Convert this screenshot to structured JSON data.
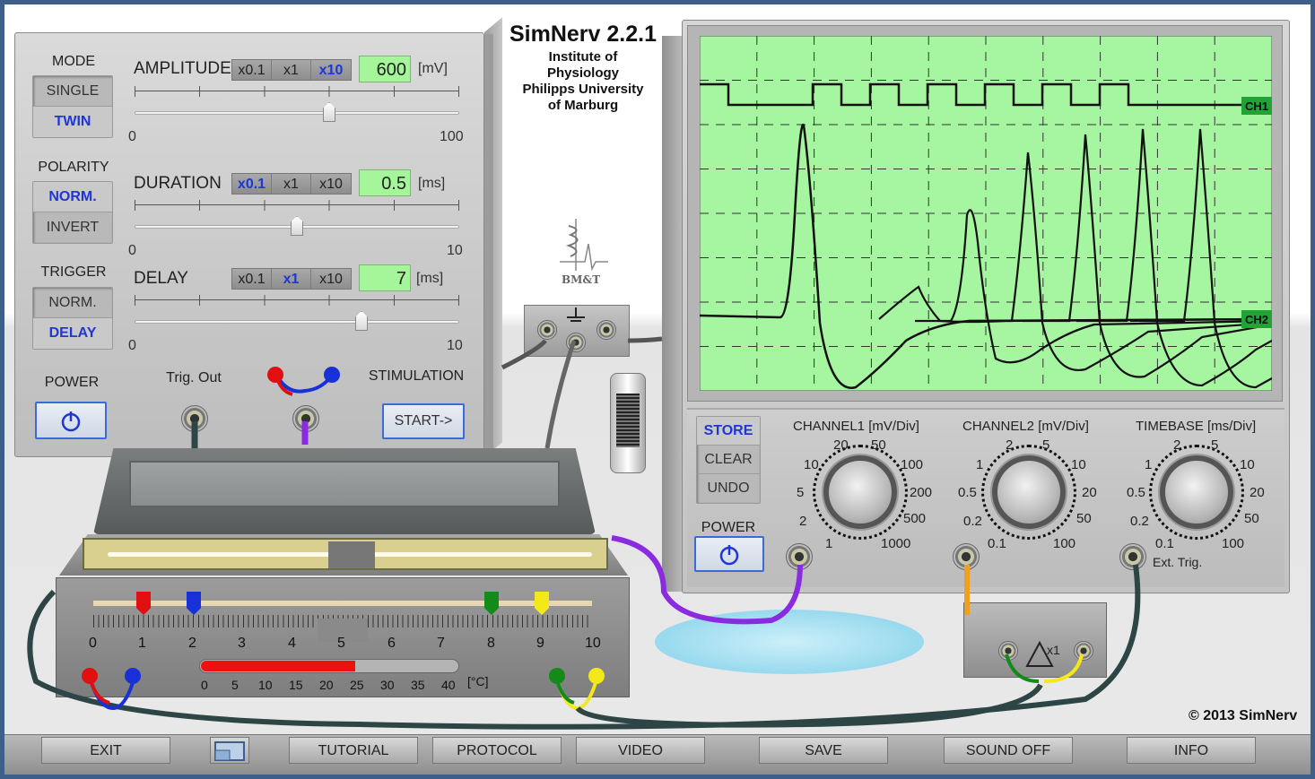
{
  "app": {
    "title": "SimNerv 2.2.1",
    "institute_lines": [
      "Institute of",
      "Physiology",
      "Philipps University",
      "of Marburg"
    ],
    "logo_text": "BM&T",
    "copyright": "© 2013 SimNerv"
  },
  "stimulator": {
    "mode": {
      "label": "MODE",
      "options": [
        "SINGLE",
        "TWIN"
      ],
      "selected": "TWIN"
    },
    "polarity": {
      "label": "POLARITY",
      "options": [
        "NORM.",
        "INVERT"
      ],
      "selected": "NORM."
    },
    "trigger": {
      "label": "TRIGGER",
      "options": [
        "NORM.",
        "DELAY"
      ],
      "selected": "DELAY"
    },
    "amplitude": {
      "label": "AMPLITUDE",
      "multipliers": [
        "x0.1",
        "x1",
        "x10"
      ],
      "selected": "x10",
      "value": "600",
      "unit": "[mV]",
      "min": "0",
      "max": "100",
      "slider_fraction": 0.6
    },
    "duration": {
      "label": "DURATION",
      "multipliers": [
        "x0.1",
        "x1",
        "x10"
      ],
      "selected": "x0.1",
      "value": "0.5",
      "unit": "[ms]",
      "min": "0",
      "max": "10",
      "slider_fraction": 0.5
    },
    "delay": {
      "label": "DELAY",
      "multipliers": [
        "x0.1",
        "x1",
        "x10"
      ],
      "selected": "x1",
      "value": "7",
      "unit": "[ms]",
      "min": "0",
      "max": "10",
      "slider_fraction": 0.7
    },
    "power_label": "POWER",
    "trig_out_label": "Trig. Out",
    "stimulation_label": "STIMULATION",
    "start_label": "START->"
  },
  "oscilloscope": {
    "ch1_label": "CH1",
    "ch2_label": "CH2",
    "buttons": [
      "STORE",
      "CLEAR",
      "UNDO"
    ],
    "active_button": "STORE",
    "power_label": "POWER",
    "channel1": {
      "title": "CHANNEL1 [mV/Div]",
      "scale": [
        "1",
        "2",
        "5",
        "10",
        "20",
        "50",
        "100",
        "200",
        "500",
        "1000"
      ]
    },
    "channel2": {
      "title": "CHANNEL2 [mV/Div]",
      "scale": [
        "0.1",
        "0.2",
        "0.5",
        "1",
        "2",
        "5",
        "10",
        "20",
        "50",
        "100"
      ]
    },
    "timebase": {
      "title": "TIMEBASE [ms/Div]",
      "scale": [
        "0.1",
        "0.2",
        "0.5",
        "1",
        "2",
        "5",
        "10",
        "20",
        "50",
        "100"
      ]
    },
    "ext_trig_label": "Ext. Trig.",
    "screen_color": "#a6f5a0"
  },
  "chamber": {
    "ruler": [
      "0",
      "1",
      "2",
      "3",
      "4",
      "5",
      "6",
      "7",
      "8",
      "9",
      "10"
    ],
    "temperature_scale": [
      "0",
      "5",
      "10",
      "15",
      "20",
      "25",
      "30",
      "35",
      "40"
    ],
    "temperature_unit": "[°C]",
    "temperature_fill_fraction": 0.6
  },
  "amplifier": {
    "gain_label": "x1"
  },
  "toolbar": {
    "buttons": [
      "EXIT",
      "TUTORIAL",
      "PROTOCOL",
      "VIDEO",
      "SAVE",
      "SOUND OFF",
      "INFO"
    ]
  }
}
